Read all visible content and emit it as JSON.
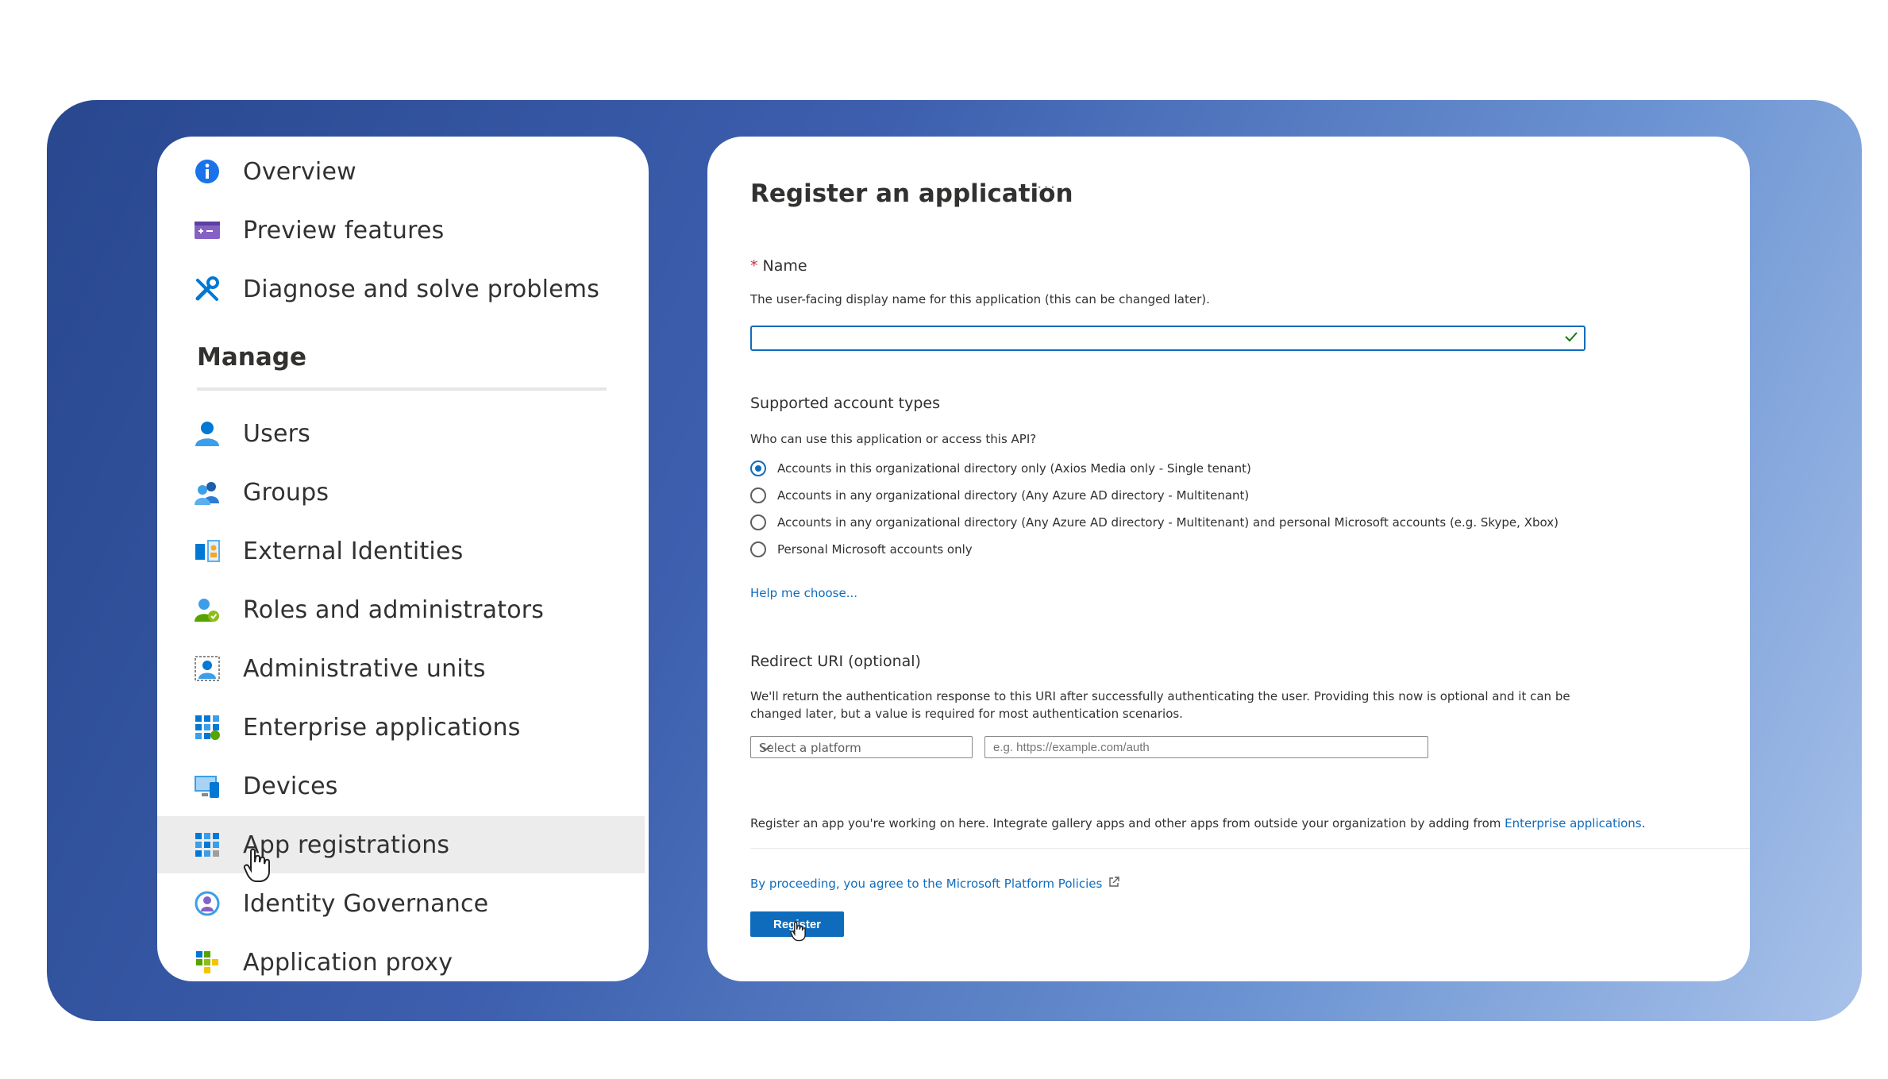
{
  "nav": {
    "top_items": [
      {
        "label": "Overview",
        "icon": "info-icon"
      },
      {
        "label": "Preview features",
        "icon": "preview-icon"
      },
      {
        "label": "Diagnose and solve problems",
        "icon": "wrench-icon"
      }
    ],
    "section_title": "Manage",
    "manage_items": [
      {
        "label": "Users",
        "icon": "user-icon"
      },
      {
        "label": "Groups",
        "icon": "group-icon"
      },
      {
        "label": "External Identities",
        "icon": "external-identities-icon"
      },
      {
        "label": "Roles and administrators",
        "icon": "roles-icon"
      },
      {
        "label": "Administrative units",
        "icon": "admin-units-icon"
      },
      {
        "label": "Enterprise applications",
        "icon": "enterprise-apps-icon"
      },
      {
        "label": "Devices",
        "icon": "devices-icon"
      },
      {
        "label": "App registrations",
        "icon": "app-registrations-icon",
        "active": true
      },
      {
        "label": "Identity Governance",
        "icon": "identity-governance-icon"
      },
      {
        "label": "Application proxy",
        "icon": "application-proxy-icon"
      }
    ]
  },
  "form": {
    "title": "Register an application",
    "more": "···",
    "name": {
      "required_mark": "*",
      "label": "Name",
      "help": "The user-facing display name for this application (this can be changed later).",
      "value": ""
    },
    "account_types": {
      "label": "Supported account types",
      "question": "Who can use this application or access this API?",
      "options": [
        {
          "label": "Accounts in this organizational directory only (Axios Media only - Single tenant)",
          "selected": true
        },
        {
          "label": "Accounts in any organizational directory (Any Azure AD directory - Multitenant)",
          "selected": false
        },
        {
          "label": "Accounts in any organizational directory (Any Azure AD directory - Multitenant) and personal Microsoft accounts (e.g. Skype, Xbox)",
          "selected": false
        },
        {
          "label": "Personal Microsoft accounts only",
          "selected": false
        }
      ],
      "help_link": "Help me choose..."
    },
    "redirect": {
      "label": "Redirect URI (optional)",
      "help_line1": "We'll return the authentication response to this URI after successfully authenticating the user. Providing this now is optional and it can be",
      "help_line2": "changed later, but a value is required for most authentication scenarios.",
      "platform_placeholder": "Select a platform",
      "uri_placeholder": "e.g. https://example.com/auth"
    },
    "footer_note": "Register an app you're working on here. Integrate gallery apps and other apps from outside your organization by adding from",
    "footer_link": "Enterprise applications",
    "footer_end": ".",
    "policy_link": "By proceeding, you agree to the Microsoft Platform Policies",
    "register_label": "Register"
  },
  "colors": {
    "accent": "#0f6cbd",
    "banner_start": "#28478f",
    "banner_end": "#a8c2ea",
    "active_nav_bg": "#ececec"
  }
}
